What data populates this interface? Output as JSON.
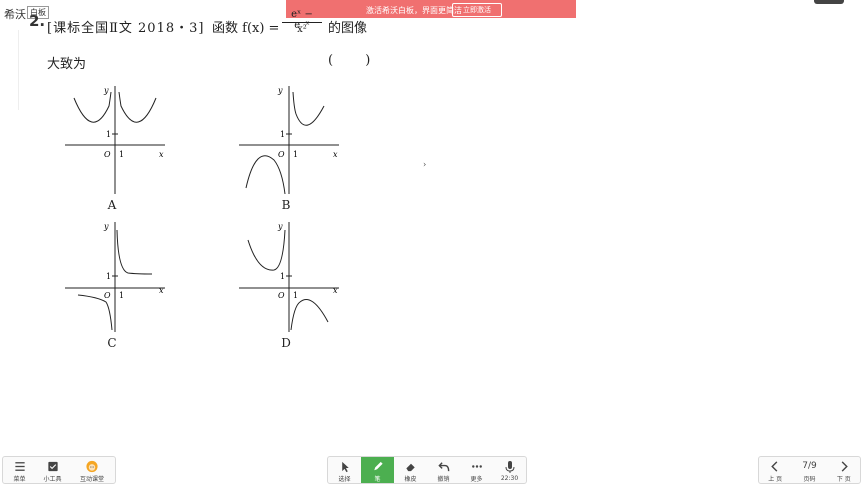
{
  "brand": {
    "name": "希沃",
    "tag": "白板"
  },
  "banner": {
    "text": "激活希沃白板，界面更简洁",
    "button": "立即激活"
  },
  "question": {
    "number": "2.",
    "source": "[课标全国Ⅱ文 2018・3]",
    "func_prefix": "函数 f(x) =",
    "numerator": "eˣ − e⁻ˣ",
    "denominator": "x²",
    "suffix": "的图像",
    "line2": "大致为",
    "paren": "( )"
  },
  "graphs": [
    {
      "label": "A",
      "x_axis": "x",
      "y_axis": "y",
      "origin": "O",
      "tick_x": "1",
      "tick_y": "1"
    },
    {
      "label": "B",
      "x_axis": "x",
      "y_axis": "y",
      "origin": "O",
      "tick_x": "1",
      "tick_y": "1"
    },
    {
      "label": "C",
      "x_axis": "x",
      "y_axis": "y",
      "origin": "O",
      "tick_x": "1",
      "tick_y": "1"
    },
    {
      "label": "D",
      "x_axis": "x",
      "y_axis": "y",
      "origin": "O",
      "tick_x": "1",
      "tick_y": "1"
    }
  ],
  "toolbar_left": [
    {
      "icon": "menu-icon",
      "label": "菜单"
    },
    {
      "icon": "widget-icon",
      "label": "小工具"
    },
    {
      "icon": "avatar-icon",
      "label": "互动课堂"
    }
  ],
  "toolbar_center": [
    {
      "icon": "cursor-icon",
      "label": "选择",
      "active": false
    },
    {
      "icon": "pen-icon",
      "label": "笔",
      "active": true
    },
    {
      "icon": "eraser-icon",
      "label": "橡皮",
      "active": false
    },
    {
      "icon": "undo-icon",
      "label": "撤销",
      "active": false
    },
    {
      "icon": "more-icon",
      "label": "更多",
      "active": false
    },
    {
      "icon": "mic-icon",
      "label": "22:30",
      "active": false
    }
  ],
  "pager": {
    "prev": "上 页",
    "page": "7/9",
    "page_label": "页码",
    "next": "下 页"
  }
}
